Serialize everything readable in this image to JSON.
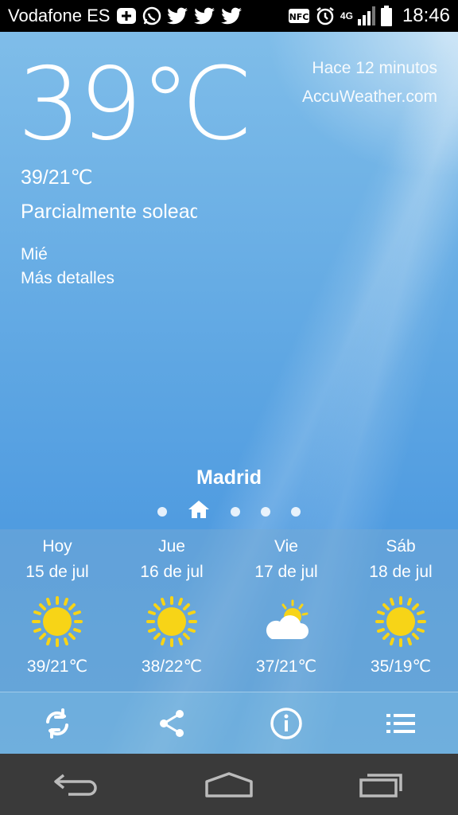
{
  "status_bar": {
    "carrier": "Vodafone ES",
    "time": "18:46",
    "network": "4G",
    "icons": [
      "plus-box-icon",
      "whatsapp-icon",
      "twitter-icon",
      "twitter-icon",
      "twitter-icon",
      "nfc-icon",
      "alarm-icon",
      "signal-icon",
      "battery-icon"
    ]
  },
  "weather": {
    "current_temp": "39℃",
    "updated": "Hace 12 minutos",
    "source": "AccuWeather.com",
    "range": "39/21℃",
    "condition": "Parcialmente soleado",
    "day": "Mié",
    "more_details": "Más detalles",
    "city": "Madrid"
  },
  "forecast": [
    {
      "day": "Hoy",
      "date": "15 de jul",
      "icon": "sun-icon",
      "range": "39/21℃"
    },
    {
      "day": "Jue",
      "date": "16 de jul",
      "icon": "sun-icon",
      "range": "38/22℃"
    },
    {
      "day": "Vie",
      "date": "17 de jul",
      "icon": "partly-cloudy-icon",
      "range": "37/21℃"
    },
    {
      "day": "Sáb",
      "date": "18 de jul",
      "icon": "sun-icon",
      "range": "35/19℃"
    }
  ],
  "toolbar": [
    "refresh-icon",
    "share-icon",
    "info-icon",
    "list-icon"
  ],
  "colors": {
    "sky_top": "#7fbde9",
    "sky_bottom": "#4f9be0",
    "sun": "#f7d417",
    "navbar": "#3a3a3a"
  }
}
